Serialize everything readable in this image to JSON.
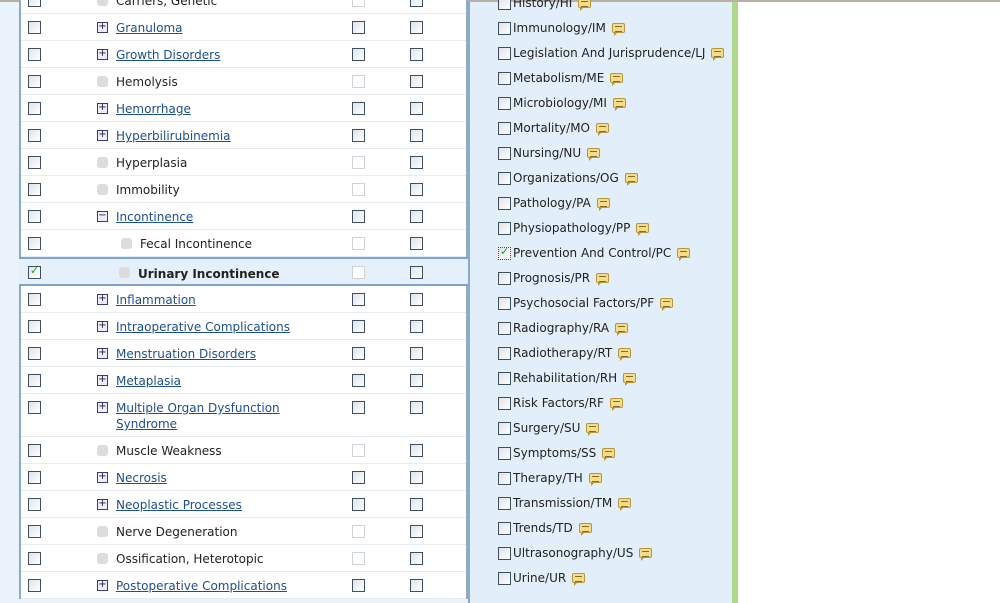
{
  "terms": [
    {
      "label": "Carriers, Genetic",
      "expand": "leaf"
    },
    {
      "label": "Granuloma",
      "expand": "plus"
    },
    {
      "label": "Growth Disorders",
      "expand": "plus"
    },
    {
      "label": "Hemolysis",
      "expand": "leaf"
    },
    {
      "label": "Hemorrhage",
      "expand": "plus"
    },
    {
      "label": "Hyperbilirubinemia",
      "expand": "plus"
    },
    {
      "label": "Hyperplasia",
      "expand": "leaf"
    },
    {
      "label": "Immobility",
      "expand": "leaf"
    },
    {
      "label": "Incontinence",
      "expand": "minus"
    },
    {
      "label": "Fecal Incontinence",
      "expand": "leaf",
      "child": true
    },
    {
      "label": "Urinary Incontinence",
      "expand": "leaf",
      "child": true,
      "selected": true,
      "checked": true
    },
    {
      "label": "Inflammation",
      "expand": "plus"
    },
    {
      "label": "Intraoperative Complications",
      "expand": "plus"
    },
    {
      "label": "Menstruation Disorders",
      "expand": "plus"
    },
    {
      "label": "Metaplasia",
      "expand": "plus"
    },
    {
      "label": "Multiple Organ Dysfunction Syndrome",
      "expand": "plus",
      "multi": true
    },
    {
      "label": "Muscle Weakness",
      "expand": "leaf"
    },
    {
      "label": "Necrosis",
      "expand": "plus"
    },
    {
      "label": "Neoplastic Processes",
      "expand": "plus"
    },
    {
      "label": "Nerve Degeneration",
      "expand": "leaf"
    },
    {
      "label": "Ossification, Heterotopic",
      "expand": "leaf"
    },
    {
      "label": "Postoperative Complications",
      "expand": "plus"
    }
  ],
  "subheadings": [
    {
      "label": "History/HI"
    },
    {
      "label": "Immunology/IM"
    },
    {
      "label": "Legislation And Jurisprudence/LJ"
    },
    {
      "label": "Metabolism/ME"
    },
    {
      "label": "Microbiology/MI"
    },
    {
      "label": "Mortality/MO"
    },
    {
      "label": "Nursing/NU"
    },
    {
      "label": "Organizations/OG"
    },
    {
      "label": "Pathology/PA"
    },
    {
      "label": "Physiopathology/PP"
    },
    {
      "label": "Prevention And Control/PC",
      "checked": true
    },
    {
      "label": "Prognosis/PR"
    },
    {
      "label": "Psychosocial Factors/PF"
    },
    {
      "label": "Radiography/RA"
    },
    {
      "label": "Radiotherapy/RT"
    },
    {
      "label": "Rehabilitation/RH"
    },
    {
      "label": "Risk Factors/RF"
    },
    {
      "label": "Surgery/SU"
    },
    {
      "label": "Symptoms/SS"
    },
    {
      "label": "Therapy/TH"
    },
    {
      "label": "Transmission/TM"
    },
    {
      "label": "Trends/TD"
    },
    {
      "label": "Ultrasonography/US"
    },
    {
      "label": "Urine/UR"
    }
  ],
  "icons": {
    "expand": "plus-box-icon",
    "collapse": "minus-box-icon",
    "note": "speech-bubble-icon"
  },
  "colors": {
    "link": "#1d4f8a",
    "panel": "#e2eefa",
    "accent_bar": "#b0d88c",
    "check": "#2c9a2c"
  }
}
